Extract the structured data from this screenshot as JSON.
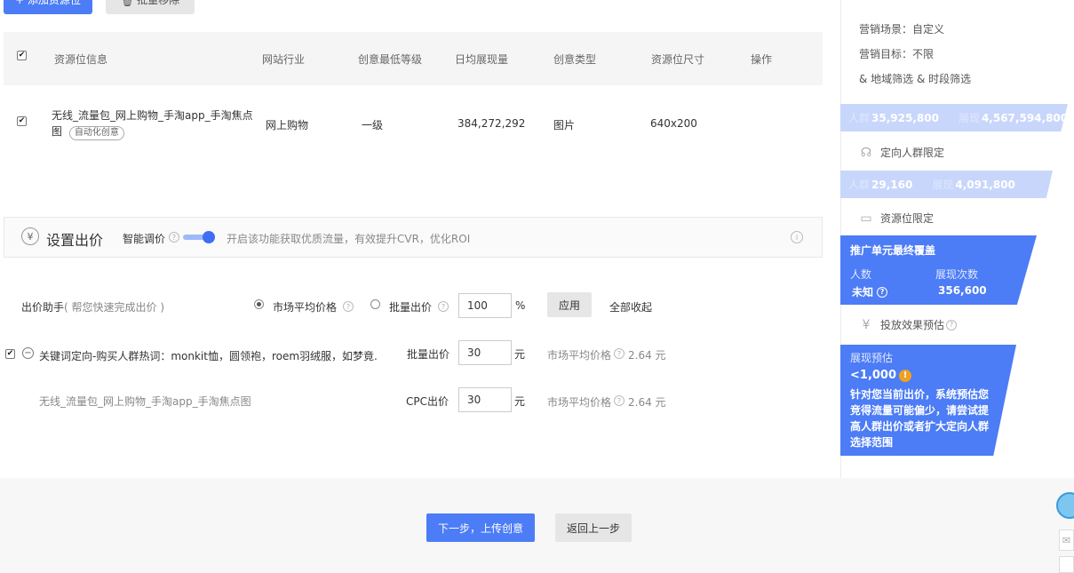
{
  "toolbar": {
    "add_label": "+ 添加资源位",
    "batch_remove_label": "批量移除",
    "batch_remove_icon": "trash-icon"
  },
  "table": {
    "headers": [
      "资源位信息",
      "网站行业",
      "创意最低等级",
      "日均展现量",
      "创意类型",
      "资源位尺寸",
      "操作"
    ],
    "rows": [
      {
        "checked": true,
        "name": "无线_流量包_网上购物_手淘app_手淘焦点图",
        "tag": "自动化创意",
        "industry": "网上购物",
        "min_level": "一级",
        "daily_impressions": "384,272,292",
        "creative_type": "图片",
        "size": "640x200"
      }
    ]
  },
  "bid_settings": {
    "title": "设置出价",
    "smart_bid_label": "智能调价",
    "smart_bid_enabled": true,
    "smart_bid_desc": "开启该功能获取优质流量，有效提升CVR，优化ROI",
    "helper_label": "出价助手",
    "helper_hint": "( 帮您快速完成出价 )",
    "option_market": "市场平均价格",
    "option_batch": "批量出价",
    "batch_value": "100",
    "percent": "%",
    "apply_label": "应用",
    "collapse_all": "全部收起",
    "group": {
      "name": "关键词定向-购买人群热词：monkit恤，圆领袍，roem羽绒服，如梦竟...",
      "bid_label": "批量出价",
      "bid_value": "30",
      "unit": "元",
      "market_label": "市场平均价格",
      "market_value": "2.64 元"
    },
    "resource_row": {
      "name": "无线_流量包_网上购物_手淘app_手淘焦点图",
      "bid_label": "CPC出价",
      "bid_value": "30",
      "unit": "元",
      "market_label": "市场平均价格",
      "market_value": "2.64 元"
    }
  },
  "footer": {
    "next_label": "下一步，上传创意",
    "back_label": "返回上一步"
  },
  "sidebar": {
    "scene": "营销场景：自定义",
    "goal": "营销目标：不限",
    "filters": "& 地域筛选 & 时段筛选",
    "band1": {
      "people_label": "人群",
      "people": "35,925,800",
      "imp_label": "展现",
      "imp": "4,567,594,800"
    },
    "crowd_limit": "定向人群限定",
    "band2": {
      "people_label": "人群",
      "people": "29,160",
      "imp_label": "展现",
      "imp": "4,091,800"
    },
    "resource_limit": "资源位限定",
    "coverage": {
      "title": "推广单元最终覆盖",
      "people_label": "人数",
      "imp_label": "展现次数",
      "people_value": "未知",
      "imp_value": "356,600"
    },
    "estimate_label": "投放效果预估",
    "estimate": {
      "title": "展现预估",
      "value": "<1,000",
      "message": "针对您当前出价，系统预估您竞得流量可能偏少，请尝试提高人群出价或者扩大定向人群选择范围"
    }
  },
  "colors": {
    "primary": "#4c7cf6",
    "band": "#c8d6fb"
  }
}
